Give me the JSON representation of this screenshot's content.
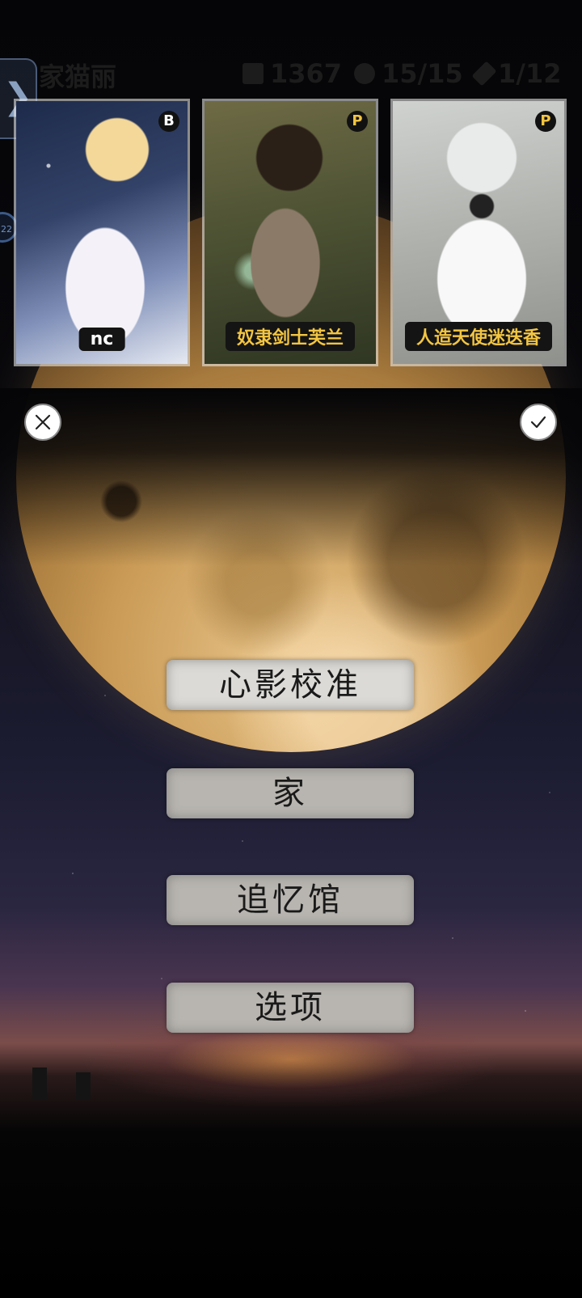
{
  "top_bar": {
    "name": "家猫丽",
    "currency": "1367",
    "capacity": "15/15",
    "progress": "1/12"
  },
  "side_tab": {
    "arrow": "❯",
    "badge": "22"
  },
  "cards": [
    {
      "label": "nc",
      "rank": "B",
      "label_color": "#ffffff",
      "rank_color": "#ffffff"
    },
    {
      "label": "奴隶剑士芙兰",
      "rank": "P",
      "label_color": "#f2c542",
      "rank_color": "#f2c542"
    },
    {
      "label": "人造天使迷迭香",
      "rank": "P",
      "label_color": "#f2c542",
      "rank_color": "#f2c542"
    }
  ],
  "actions": {
    "cancel_icon": "close-icon",
    "confirm_icon": "check-icon"
  },
  "menu": {
    "calibrate": "心影校准",
    "home": "家",
    "memory_hall": "追忆馆",
    "options": "选项"
  }
}
